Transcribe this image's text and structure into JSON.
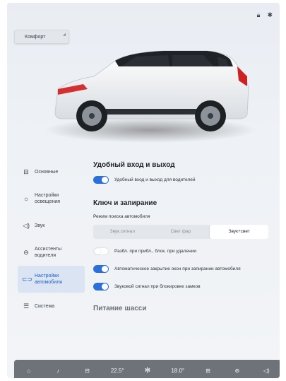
{
  "header": {
    "mode_button": "Комфорт"
  },
  "sidebar": {
    "items": [
      {
        "label": "Основные",
        "icon": "car-outline-icon"
      },
      {
        "label": "Настройки освещения",
        "icon": "light-sun-icon"
      },
      {
        "label": "Звук",
        "icon": "speaker-icon"
      },
      {
        "label": "Ассистенты водителя",
        "icon": "steering-wheel-icon"
      },
      {
        "label": "Настройки автомобиля",
        "icon": "car-settings-icon",
        "active": true
      },
      {
        "label": "Система",
        "icon": "sliders-icon"
      }
    ]
  },
  "content": {
    "section1_title": "Удобный вход и выход",
    "easy_entry_toggle_label": "Удобный вход и выход для водителей",
    "easy_entry_on": true,
    "section2_title": "Ключ и запирание",
    "search_mode_label": "Режим поиска автомобиля",
    "search_mode_options": [
      "Звук.сигнал",
      "Свет фар",
      "Звук+свет"
    ],
    "search_mode_selected": "Звук+свет",
    "unlock_toggle_label": "Разбл. при прибл., блок. при удалении",
    "unlock_on": false,
    "windows_toggle_label": "Автоматическое закрытие окон при запирании автомобиля",
    "windows_on": true,
    "horn_toggle_label": "Звуковой сигнал при блокировке замков",
    "horn_on": true,
    "section3_title": "Питание шасси"
  },
  "dock": {
    "temp_left": "22.5°",
    "temp_right": "18.0°"
  },
  "colors": {
    "accent": "#2c6fd9",
    "dock_bg": "#6e737a"
  }
}
